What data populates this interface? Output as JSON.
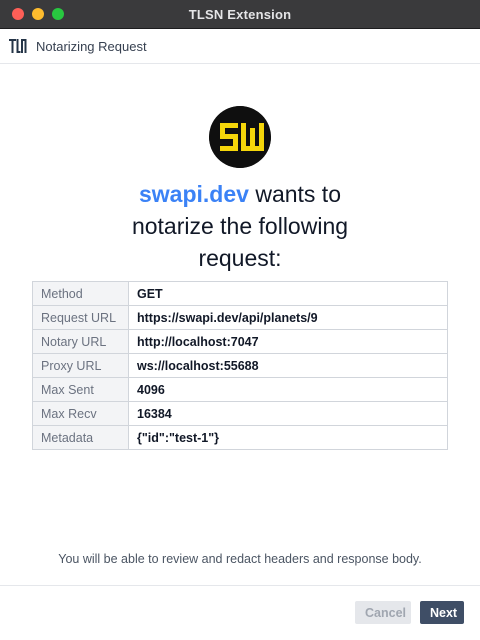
{
  "window": {
    "title": "TLSN Extension"
  },
  "header": {
    "title": "Notarizing Request",
    "logo": "tlsn-logo"
  },
  "avatar": {
    "icon": "site-favicon",
    "text": "SW"
  },
  "heading": {
    "host": "swapi.dev",
    "text": " wants to notarize the following request:"
  },
  "details": [
    {
      "label": "Method",
      "value": "GET"
    },
    {
      "label": "Request URL",
      "value": "https://swapi.dev/api/planets/9"
    },
    {
      "label": "Notary URL",
      "value": "http://localhost:7047"
    },
    {
      "label": "Proxy URL",
      "value": "ws://localhost:55688"
    },
    {
      "label": "Max Sent",
      "value": "4096"
    },
    {
      "label": "Max Recv",
      "value": "16384"
    },
    {
      "label": "Metadata",
      "value": "{\"id\":\"test-1\"}"
    }
  ],
  "footnote": "You will be able to review and redact headers and response body.",
  "buttons": {
    "cancel": "Cancel",
    "next": "Next"
  },
  "colors": {
    "accent": "#3b82f6",
    "primary_button": "#3f4e66",
    "titlebar": "#3a3a3c"
  }
}
